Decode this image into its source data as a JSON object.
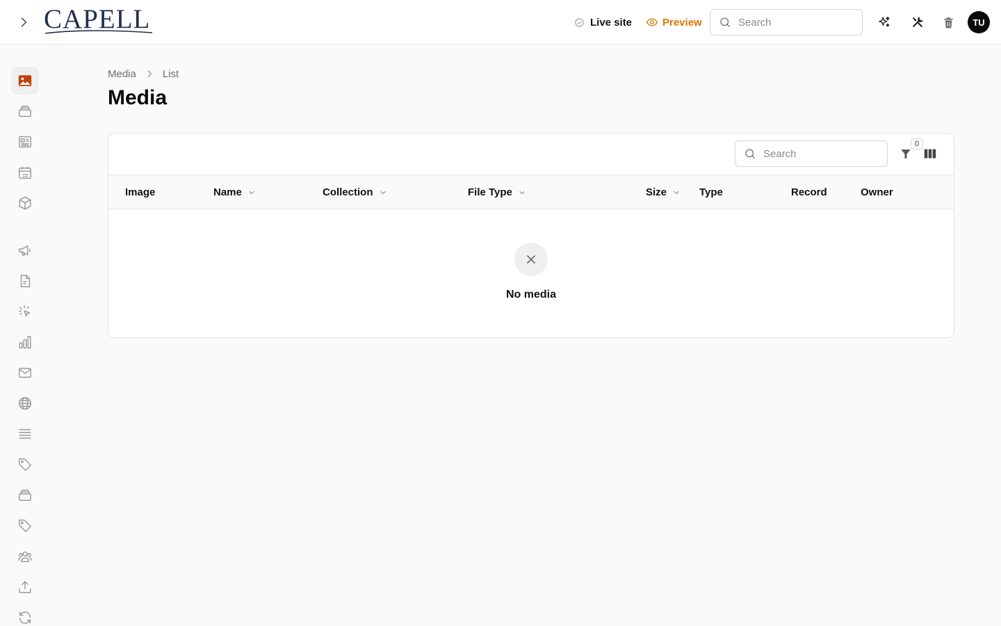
{
  "brand": {
    "name": "CAPELL"
  },
  "header": {
    "live_label": "Live site",
    "preview_label": "Preview",
    "search_placeholder": "Search",
    "avatar_initials": "TU"
  },
  "sidebar": {
    "items": [
      {
        "icon": "image-icon",
        "active": true
      },
      {
        "icon": "layers-icon"
      },
      {
        "icon": "newspaper-icon"
      },
      {
        "icon": "calendar-icon"
      },
      {
        "icon": "box-icon"
      },
      {
        "icon": "megaphone-icon"
      },
      {
        "icon": "file-text-icon"
      },
      {
        "icon": "click-icon"
      },
      {
        "icon": "bar-chart-icon"
      },
      {
        "icon": "mail-icon"
      },
      {
        "icon": "globe-icon"
      },
      {
        "icon": "list-icon"
      },
      {
        "icon": "tag-icon"
      },
      {
        "icon": "layers-icon"
      },
      {
        "icon": "tag-icon"
      },
      {
        "icon": "users-icon"
      },
      {
        "icon": "upload-icon"
      },
      {
        "icon": "refresh-icon"
      }
    ]
  },
  "breadcrumb": {
    "items": [
      "Media",
      "List"
    ]
  },
  "page": {
    "title": "Media"
  },
  "table": {
    "search_placeholder": "Search",
    "filter_count": "0",
    "columns": [
      {
        "label": "Image",
        "sortable": false
      },
      {
        "label": "Name",
        "sortable": true
      },
      {
        "label": "Collection",
        "sortable": true
      },
      {
        "label": "File Type",
        "sortable": true
      },
      {
        "label": "Size",
        "sortable": true
      },
      {
        "label": "Type",
        "sortable": false
      },
      {
        "label": "Record",
        "sortable": false
      },
      {
        "label": "Owner",
        "sortable": false
      }
    ],
    "empty_text": "No media"
  },
  "colors": {
    "accent": "#d97706",
    "active_icon": "#c2410c",
    "icon": "#9a9a9a"
  }
}
